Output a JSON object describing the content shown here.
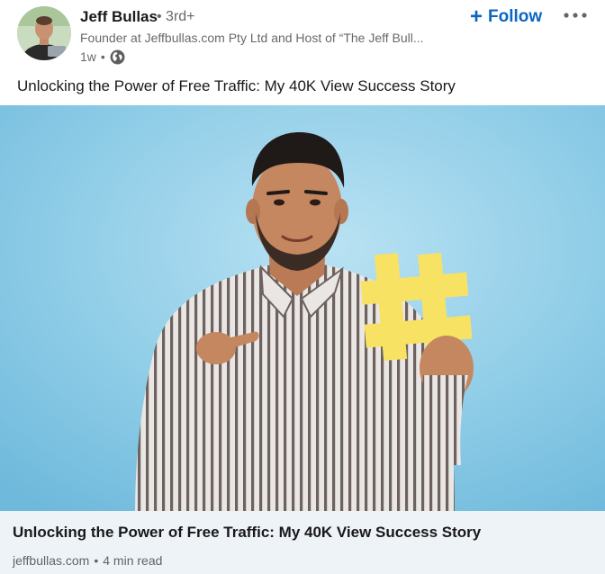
{
  "post": {
    "actor": {
      "name": "Jeff Bullas",
      "degree": "• 3rd+",
      "description": "Founder at Jeffbullas.com Pty Ltd and Host of “The Jeff Bull...",
      "time": "1w",
      "separator": "•",
      "visibility_icon": "globe-icon"
    },
    "follow": {
      "label": "Follow",
      "icon": "plus-icon"
    },
    "more_icon": "ellipsis-icon",
    "commentary": "Unlocking the Power of Free Traffic: My 40K View Success Story",
    "article": {
      "title": "Unlocking the Power of Free Traffic: My 40K View Success Story",
      "source": "jeffbullas.com",
      "separator": "•",
      "read_time": "4 min read"
    }
  },
  "colors": {
    "accent": "#0a66c2",
    "footer_bg": "#eef3f8",
    "image_bg": "#7ec3e3"
  }
}
